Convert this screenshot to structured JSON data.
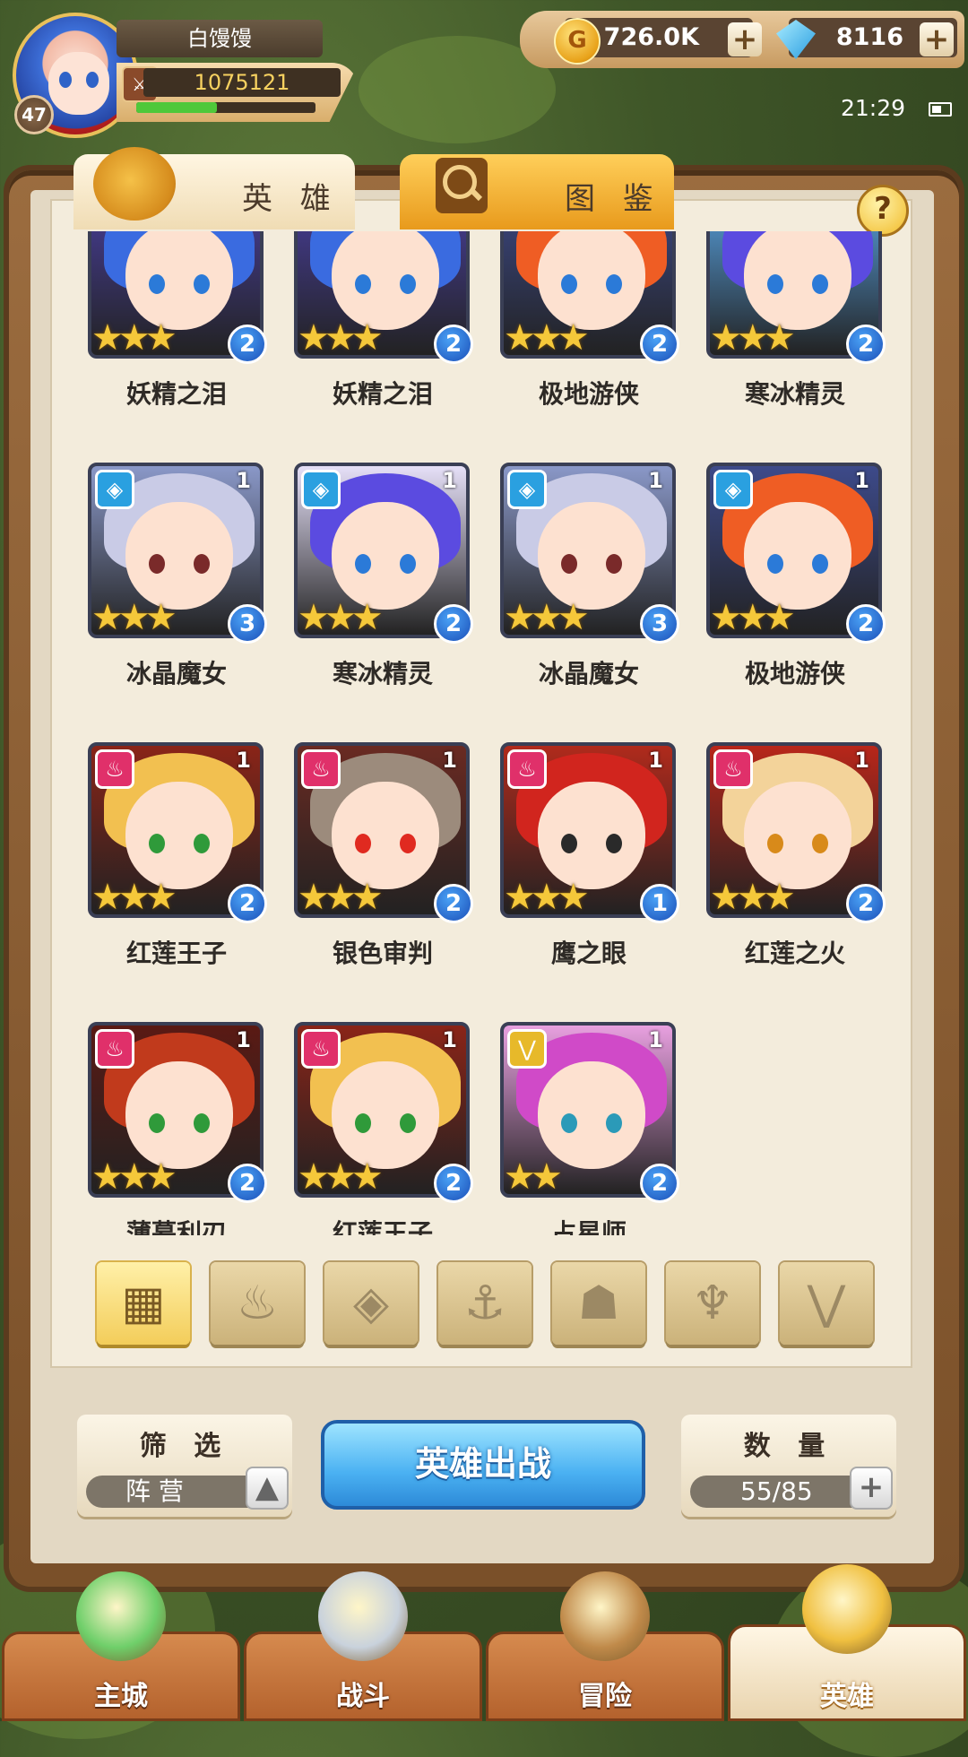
{
  "player": {
    "name": "白馒馒",
    "level": "47",
    "power": "1075121",
    "exp_fraction": 0.45
  },
  "resources": {
    "gold": "726.0K",
    "gems": "8116"
  },
  "status": {
    "time": "21:29"
  },
  "tabs": {
    "heroes": "英 雄",
    "codex": "图 鉴"
  },
  "help": "?",
  "heroes": [
    {
      "name": "妖精之泪",
      "stars": 3,
      "level": "2",
      "count": "",
      "faction": "",
      "hair": "#3a6be0",
      "bg": "#4a3fa0",
      "eye": "#2b7ad8"
    },
    {
      "name": "妖精之泪",
      "stars": 3,
      "level": "2",
      "count": "",
      "faction": "",
      "hair": "#3a6be0",
      "bg": "#4a3fa0",
      "eye": "#2b7ad8"
    },
    {
      "name": "极地游侠",
      "stars": 3,
      "level": "2",
      "count": "",
      "faction": "",
      "hair": "#ef5d24",
      "bg": "#3d4a8a",
      "eye": "#2b7ad8"
    },
    {
      "name": "寒冰精灵",
      "stars": 3,
      "level": "2",
      "count": "",
      "faction": "",
      "hair": "#5b4be0",
      "bg": "#5aa7e8",
      "eye": "#2b7ad8"
    },
    {
      "name": "冰晶魔女",
      "stars": 3,
      "level": "3",
      "count": "1",
      "faction": "water",
      "hair": "#c9cbe6",
      "bg": "#8a98c8",
      "eye": "#7a2a2a"
    },
    {
      "name": "寒冰精灵",
      "stars": 3,
      "level": "2",
      "count": "1",
      "faction": "water",
      "hair": "#5b4be0",
      "bg": "#e6e0f8",
      "eye": "#2b7ad8"
    },
    {
      "name": "冰晶魔女",
      "stars": 3,
      "level": "3",
      "count": "1",
      "faction": "water",
      "hair": "#c9cbe6",
      "bg": "#8a98c8",
      "eye": "#7a2a2a"
    },
    {
      "name": "极地游侠",
      "stars": 3,
      "level": "2",
      "count": "1",
      "faction": "water",
      "hair": "#ef5d24",
      "bg": "#3d4a8a",
      "eye": "#2b7ad8"
    },
    {
      "name": "红莲王子",
      "stars": 3,
      "level": "2",
      "count": "1",
      "faction": "fire",
      "hair": "#f2c050",
      "bg": "#8a2418",
      "eye": "#2f9a3a"
    },
    {
      "name": "银色审判",
      "stars": 3,
      "level": "2",
      "count": "1",
      "faction": "fire",
      "hair": "#9c8b7c",
      "bg": "#6a2a22",
      "eye": "#e02a20"
    },
    {
      "name": "鹰之眼",
      "stars": 3,
      "level": "1",
      "count": "1",
      "faction": "fire",
      "hair": "#d1251e",
      "bg": "#b02a1c",
      "eye": "#2a2a2a"
    },
    {
      "name": "红莲之火",
      "stars": 3,
      "level": "2",
      "count": "1",
      "faction": "fire",
      "hair": "#f3d39a",
      "bg": "#b8261a",
      "eye": "#d88a1a"
    },
    {
      "name": "薄暮利刃",
      "stars": 3,
      "level": "2",
      "count": "1",
      "faction": "fire",
      "hair": "#c13a1c",
      "bg": "#5a1a14",
      "eye": "#2f9a3a"
    },
    {
      "name": "红莲王子",
      "stars": 3,
      "level": "2",
      "count": "1",
      "faction": "fire",
      "hair": "#f2c050",
      "bg": "#8a2418",
      "eye": "#2f9a3a"
    },
    {
      "name": "占星师",
      "stars": 2,
      "level": "2",
      "count": "1",
      "faction": "light",
      "hair": "#d04ac8",
      "bg": "#e8a0e0",
      "eye": "#2b9ab8"
    }
  ],
  "faction_filters": [
    {
      "icon": "all-grid",
      "glyph": "▦",
      "selected": true
    },
    {
      "icon": "fire-faction",
      "glyph": "♨",
      "selected": false
    },
    {
      "icon": "water-faction",
      "glyph": "◈",
      "selected": false
    },
    {
      "icon": "anchor-faction",
      "glyph": "⚓",
      "selected": false
    },
    {
      "icon": "beast-faction",
      "glyph": "☗",
      "selected": false
    },
    {
      "icon": "demon-faction",
      "glyph": "♆",
      "selected": false
    },
    {
      "icon": "light-faction",
      "glyph": "⋁",
      "selected": false
    }
  ],
  "controls": {
    "filter_title": "筛 选",
    "filter_value": "阵 营",
    "deploy": "英雄出战",
    "count_title": "数 量",
    "count_value": "55/85"
  },
  "nav": [
    {
      "label": "主城",
      "icon": "main-city-icon",
      "active": false
    },
    {
      "label": "战斗",
      "icon": "battle-icon",
      "active": false
    },
    {
      "label": "冒险",
      "icon": "adventure-icon",
      "active": false
    },
    {
      "label": "英雄",
      "icon": "hero-icon",
      "active": true
    }
  ],
  "colors": {
    "water": "#2aa0e0",
    "fire": "#e0306a",
    "light": "#e7b92a"
  }
}
